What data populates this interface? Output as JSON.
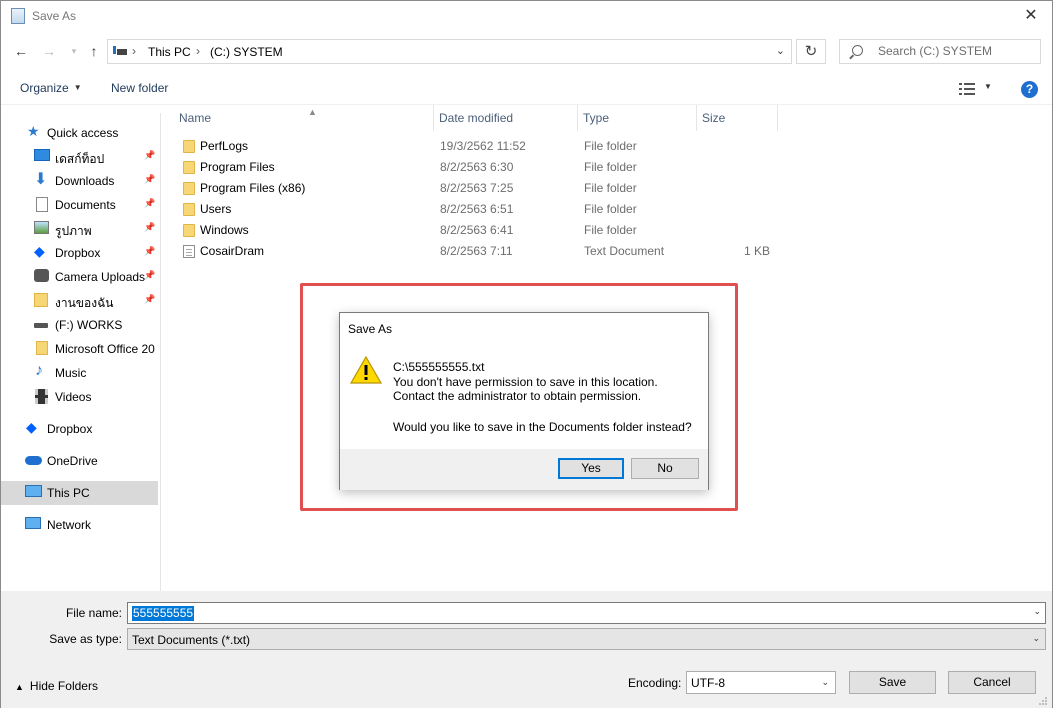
{
  "window": {
    "title": "Save As",
    "close_symbol": "✕"
  },
  "address": {
    "crumbs": [
      "This PC",
      "(C:) SYSTEM"
    ],
    "search_placeholder": "Search (C:) SYSTEM"
  },
  "toolbar": {
    "organize_label": "Organize",
    "new_folder_label": "New folder"
  },
  "sidebar": {
    "items": [
      {
        "label": "Quick access",
        "icon": "star-icon",
        "pinned": false
      },
      {
        "label": "เดสก์ท็อป",
        "icon": "desktop-icon",
        "pinned": true
      },
      {
        "label": "Downloads",
        "icon": "download-icon",
        "pinned": true
      },
      {
        "label": "Documents",
        "icon": "documents-icon",
        "pinned": true
      },
      {
        "label": "รูปภาพ",
        "icon": "pictures-icon",
        "pinned": true
      },
      {
        "label": "Dropbox",
        "icon": "dropbox-icon",
        "pinned": true
      },
      {
        "label": "Camera Uploads",
        "icon": "camera-icon",
        "pinned": true
      },
      {
        "label": "งานของฉัน",
        "icon": "folder-check-icon",
        "pinned": true
      },
      {
        "label": "(F:) WORKS",
        "icon": "drive-icon",
        "pinned": false
      },
      {
        "label": "Microsoft Office 20",
        "icon": "folder-icon",
        "pinned": false
      },
      {
        "label": "Music",
        "icon": "music-icon",
        "pinned": false
      },
      {
        "label": "Videos",
        "icon": "videos-icon",
        "pinned": false
      },
      {
        "label": "Dropbox",
        "icon": "dropbox-icon",
        "pinned": false
      },
      {
        "label": "OneDrive",
        "icon": "onedrive-icon",
        "pinned": false
      },
      {
        "label": "This PC",
        "icon": "pc-icon",
        "pinned": false,
        "selected": true
      },
      {
        "label": "Network",
        "icon": "network-icon",
        "pinned": false
      }
    ]
  },
  "filelist": {
    "headers": {
      "name": "Name",
      "date": "Date modified",
      "type": "Type",
      "size": "Size"
    },
    "rows": [
      {
        "name": "PerfLogs",
        "date": "19/3/2562 11:52",
        "type": "File folder",
        "size": "",
        "icon": "folder-icon"
      },
      {
        "name": "Program Files",
        "date": "8/2/2563 6:30",
        "type": "File folder",
        "size": "",
        "icon": "folder-icon"
      },
      {
        "name": "Program Files (x86)",
        "date": "8/2/2563 7:25",
        "type": "File folder",
        "size": "",
        "icon": "folder-icon"
      },
      {
        "name": "Users",
        "date": "8/2/2563 6:51",
        "type": "File folder",
        "size": "",
        "icon": "folder-icon"
      },
      {
        "name": "Windows",
        "date": "8/2/2563 6:41",
        "type": "File folder",
        "size": "",
        "icon": "folder-icon"
      },
      {
        "name": "CosairDram",
        "date": "8/2/2563 7:11",
        "type": "Text Document",
        "size": "1 KB",
        "icon": "text-document-icon"
      }
    ]
  },
  "dialog": {
    "title": "Save As",
    "path": "C:\\555555555.txt",
    "line1": "You don't have permission to save in this location.",
    "line2": "Contact the administrator to obtain permission.",
    "question": "Would you like to save in the Documents folder instead?",
    "yes_label": "Yes",
    "no_label": "No",
    "highlight_color": "#e15050"
  },
  "bottom": {
    "file_name_label": "File name:",
    "file_name_value": "555555555",
    "save_type_label": "Save as type:",
    "save_type_value": "Text Documents (*.txt)",
    "hide_folders_label": "Hide Folders",
    "encoding_label": "Encoding:",
    "encoding_value": "UTF-8",
    "save_label": "Save",
    "cancel_label": "Cancel"
  }
}
